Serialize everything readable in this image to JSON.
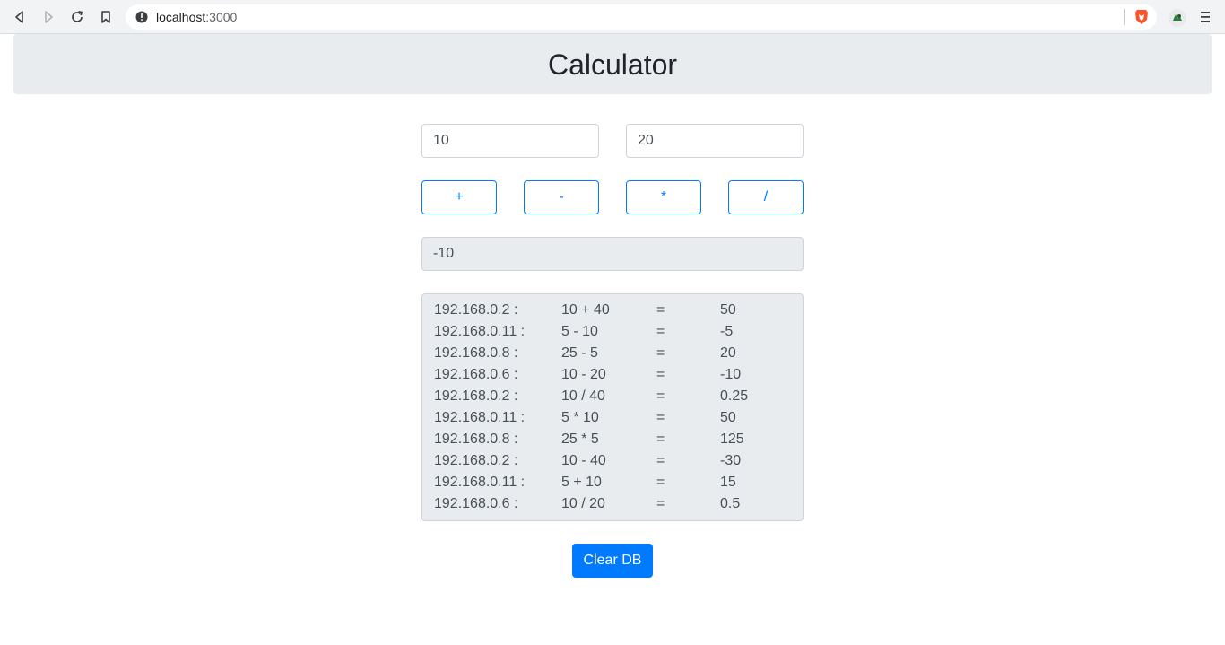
{
  "browser": {
    "url_host": "localhost",
    "url_port": ":3000"
  },
  "page": {
    "title": "Calculator"
  },
  "inputs": {
    "first_value": "10",
    "second_value": "20"
  },
  "operators": {
    "add": "+",
    "subtract": "-",
    "multiply": "*",
    "divide": "/"
  },
  "result": "-10",
  "history": [
    {
      "ip": "192.168.0.2 :",
      "expr": "10 + 40",
      "eq": "=",
      "result": "50"
    },
    {
      "ip": "192.168.0.11 :",
      "expr": "5 - 10",
      "eq": "=",
      "result": "-5"
    },
    {
      "ip": "192.168.0.8 :",
      "expr": "25 - 5",
      "eq": "=",
      "result": "20"
    },
    {
      "ip": "192.168.0.6 :",
      "expr": "10 - 20",
      "eq": "=",
      "result": "-10"
    },
    {
      "ip": "192.168.0.2 :",
      "expr": "10 / 40",
      "eq": "=",
      "result": "0.25"
    },
    {
      "ip": "192.168.0.11 :",
      "expr": "5 * 10",
      "eq": "=",
      "result": "50"
    },
    {
      "ip": "192.168.0.8 :",
      "expr": "25 * 5",
      "eq": "=",
      "result": "125"
    },
    {
      "ip": "192.168.0.2 :",
      "expr": "10 - 40",
      "eq": "=",
      "result": "-30"
    },
    {
      "ip": "192.168.0.11 :",
      "expr": "5 + 10",
      "eq": "=",
      "result": "15"
    },
    {
      "ip": "192.168.0.6 :",
      "expr": "10 / 20",
      "eq": "=",
      "result": "0.5"
    }
  ],
  "clear_button": "Clear DB",
  "colors": {
    "primary": "#007bff",
    "card_bg": "#e9ecef",
    "border": "#ced4da"
  }
}
